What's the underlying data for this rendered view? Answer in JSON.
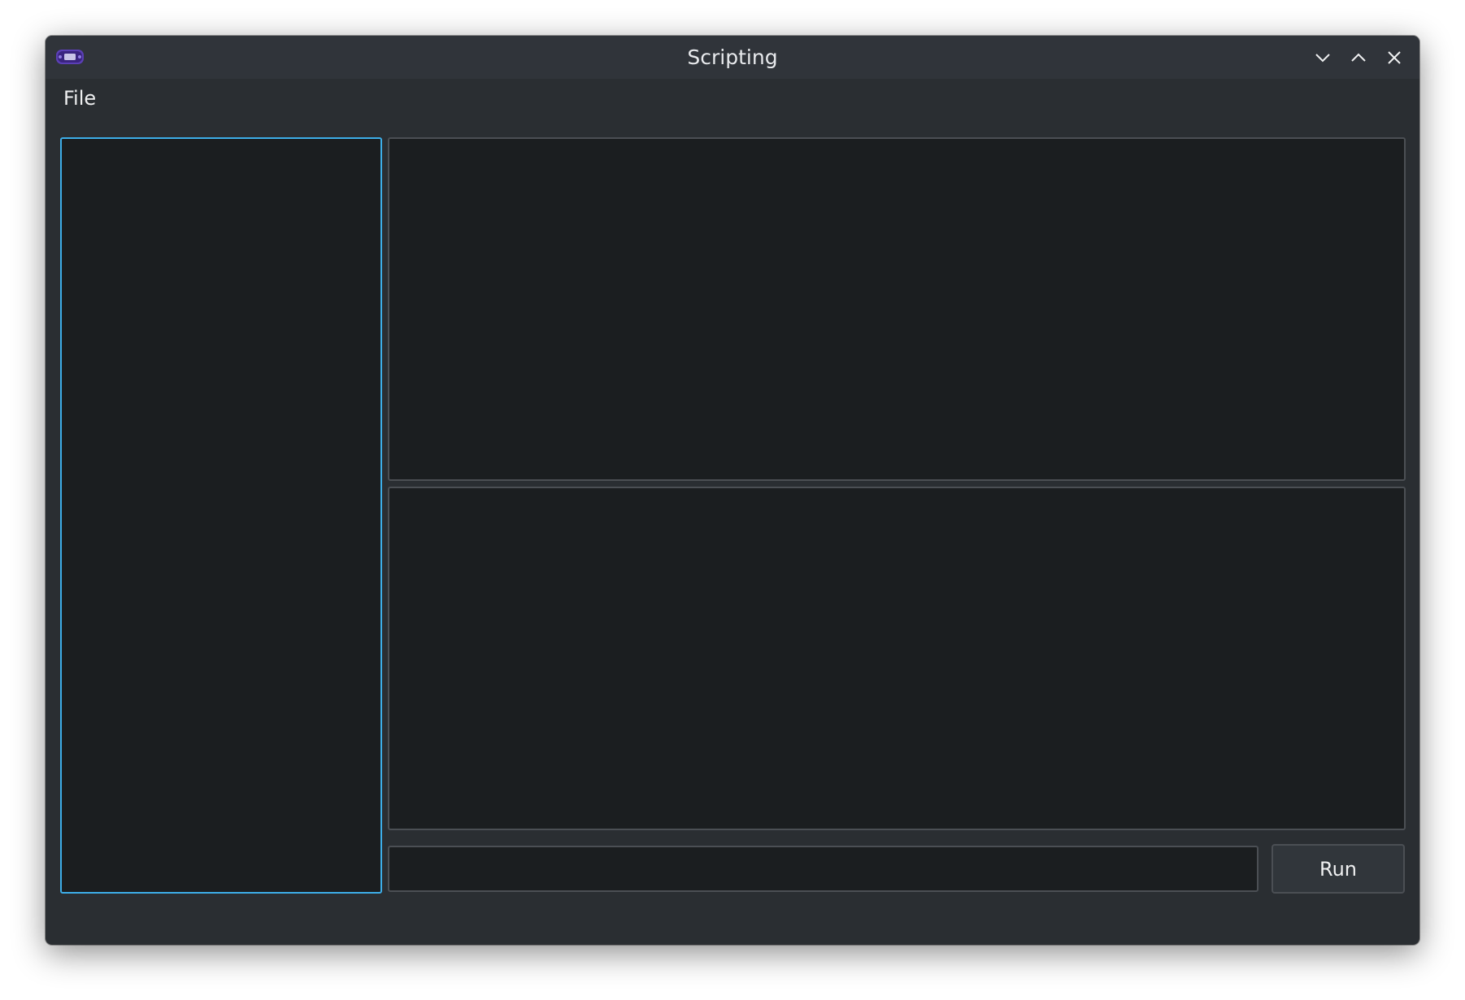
{
  "window": {
    "title": "Scripting",
    "app_icon": "app-icon",
    "controls": [
      "minimize-icon",
      "maximize-icon",
      "close-icon"
    ]
  },
  "menubar": {
    "items": [
      {
        "label": "File"
      }
    ]
  },
  "console": {
    "input_value": "",
    "run_label": "Run"
  },
  "colors": {
    "window_bg": "#2a2e32",
    "panel_bg": "#1b1e20",
    "focus_border": "#3daee9",
    "border": "#4b4f54",
    "text": "#eff0f1"
  }
}
